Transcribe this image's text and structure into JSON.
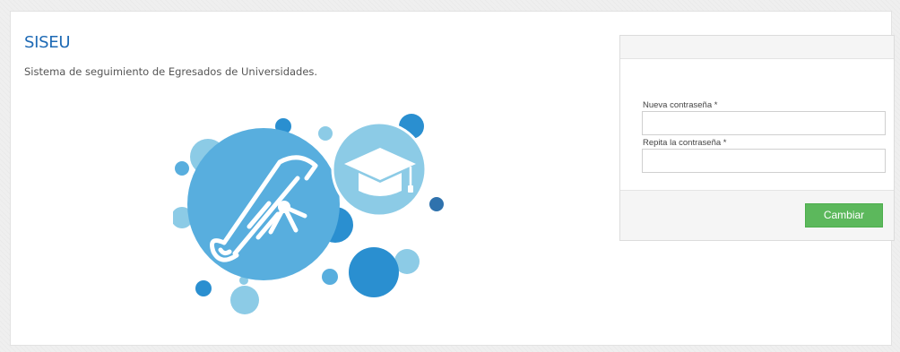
{
  "app": {
    "title": "SISEU",
    "subtitle": "Sistema de seguimiento de Egresados de Universidades."
  },
  "form": {
    "new_password_label": "Nueva contraseña *",
    "new_password_value": "",
    "repeat_password_label": "Repita la contraseña *",
    "repeat_password_value": "",
    "submit_label": "Cambiar"
  },
  "illustration": {
    "icons": [
      "diploma-icon",
      "graduation-cap-icon"
    ]
  },
  "colors": {
    "brand": "#1e6ab5",
    "submit": "#5cb85c",
    "bubble_dark": "#2a8fd0",
    "bubble_mid": "#58aede",
    "bubble_light": "#8ccbe6"
  }
}
